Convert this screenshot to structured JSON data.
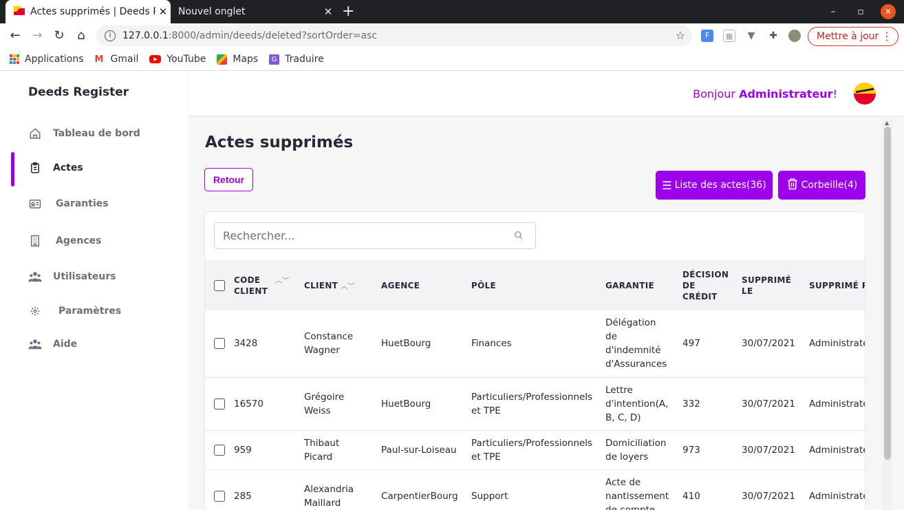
{
  "browser": {
    "tabs": [
      {
        "title": "Actes supprimés | Deeds R",
        "active": true
      },
      {
        "title": "Nouvel onglet",
        "active": false
      }
    ],
    "url_host": "127.0.0.1",
    "url_path": ":8000/admin/deeds/deleted?sortOrder=asc",
    "update_label": "Mettre à jour",
    "bookmarks": [
      "Applications",
      "Gmail",
      "YouTube",
      "Maps",
      "Traduire"
    ]
  },
  "app": {
    "brand": "Deeds Register",
    "greeting_prefix": "Bonjour ",
    "greeting_user": "Administrateur",
    "greeting_suffix": "!",
    "nav": [
      {
        "label": "Tableau de bord",
        "icon": "home-icon"
      },
      {
        "label": "Actes",
        "icon": "clipboard-icon",
        "active": true
      },
      {
        "label": "Garanties",
        "icon": "id-card-icon"
      },
      {
        "label": "Agences",
        "icon": "building-icon"
      },
      {
        "label": "Utilisateurs",
        "icon": "users-icon"
      },
      {
        "label": "Paramètres",
        "icon": "gear-icon"
      },
      {
        "label": "Aide",
        "icon": "users-icon"
      }
    ],
    "accent_color": "#9d00ea"
  },
  "page": {
    "title": "Actes supprimés",
    "back_label": "Retour",
    "list_button_label": "Liste des actes(36)",
    "trash_button_label": "Corbeille(4)",
    "search_placeholder": "Rechercher..."
  },
  "table": {
    "headers": {
      "code_client": "CODE CLIENT",
      "client": "CLIENT",
      "agence": "AGENCE",
      "pole": "PÔLE",
      "garantie": "GARANTIE",
      "decision": "DÉCISION DE CRÉDIT",
      "supprime_le": "SUPPRIMÉ LE",
      "supprime_par": "SUPPRIMÉ PAR"
    },
    "rows": [
      {
        "code": "3428",
        "client": "Constance Wagner",
        "agence": "HuetBourg",
        "pole": "Finances",
        "garantie": "Délégation de d'indemnité d'Assurances",
        "decision": "497",
        "date": "30/07/2021",
        "by": "Administrateur"
      },
      {
        "code": "16570",
        "client": "Grégoire Weiss",
        "agence": "HuetBourg",
        "pole": "Particuliers/Professionnels et TPE",
        "garantie": "Lettre d'intention(A, B, C, D)",
        "decision": "332",
        "date": "30/07/2021",
        "by": "Administrateur"
      },
      {
        "code": "959",
        "client": "Thibaut Picard",
        "agence": "Paul-sur-Loiseau",
        "pole": "Particuliers/Professionnels et TPE",
        "garantie": "Domiciliation de loyers",
        "decision": "973",
        "date": "30/07/2021",
        "by": "Administrateur"
      },
      {
        "code": "285",
        "client": "Alexandria Maillard",
        "agence": "CarpentierBourg",
        "pole": "Support",
        "garantie": "Acte de nantissement de compte",
        "decision": "410",
        "date": "30/07/2021",
        "by": "Administrateur"
      }
    ]
  }
}
